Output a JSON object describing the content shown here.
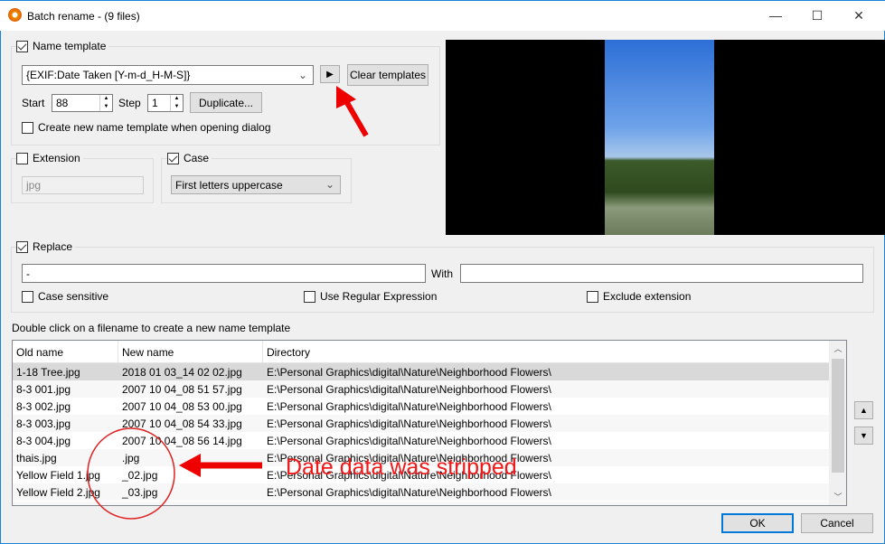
{
  "window": {
    "title": "Batch rename - (9 files)",
    "minimize": "—",
    "maximize": "☐",
    "close": "✕"
  },
  "name_template": {
    "label": "Name template",
    "checked": true,
    "value": "{EXIF:Date Taken [Y-m-d_H-M-S]}",
    "play": "▶",
    "clear": "Clear templates",
    "start_label": "Start",
    "start": "88",
    "step_label": "Step",
    "step": "1",
    "duplicate": "Duplicate...",
    "create_new_label": "Create new name template when opening dialog"
  },
  "extension": {
    "label": "Extension",
    "checked": false,
    "value": "jpg"
  },
  "case": {
    "label": "Case",
    "checked": true,
    "value": "First letters uppercase"
  },
  "replace": {
    "label": "Replace",
    "checked": true,
    "value": "-",
    "with_label": "With",
    "with_value": "",
    "case_sensitive": "Case sensitive",
    "regex": "Use Regular Expression",
    "exclude_ext": "Exclude extension"
  },
  "hint": "Double click on a filename to create a new name template",
  "list": {
    "columns": [
      "Old name",
      "New name",
      "Directory"
    ],
    "rows": [
      [
        "1-18 Tree.jpg",
        "2018 01 03_14 02 02.jpg",
        "E:\\Personal Graphics\\digital\\Nature\\Neighborhood Flowers\\"
      ],
      [
        "8-3 001.jpg",
        "2007 10 04_08 51 57.jpg",
        "E:\\Personal Graphics\\digital\\Nature\\Neighborhood Flowers\\"
      ],
      [
        "8-3 002.jpg",
        "2007 10 04_08 53 00.jpg",
        "E:\\Personal Graphics\\digital\\Nature\\Neighborhood Flowers\\"
      ],
      [
        "8-3 003.jpg",
        "2007 10 04_08 54 33.jpg",
        "E:\\Personal Graphics\\digital\\Nature\\Neighborhood Flowers\\"
      ],
      [
        "8-3 004.jpg",
        "2007 10 04_08 56 14.jpg",
        "E:\\Personal Graphics\\digital\\Nature\\Neighborhood Flowers\\"
      ],
      [
        "thais.jpg",
        ".jpg",
        "E:\\Personal Graphics\\digital\\Nature\\Neighborhood Flowers\\"
      ],
      [
        "Yellow Field 1.jpg",
        "_02.jpg",
        "E:\\Personal Graphics\\digital\\Nature\\Neighborhood Flowers\\"
      ],
      [
        "Yellow Field 2.jpg",
        "_03.jpg",
        "E:\\Personal Graphics\\digital\\Nature\\Neighborhood Flowers\\"
      ]
    ]
  },
  "annotation": "Date data was stripped",
  "buttons": {
    "ok": "OK",
    "cancel": "Cancel",
    "up": "▲",
    "down": "▼"
  }
}
